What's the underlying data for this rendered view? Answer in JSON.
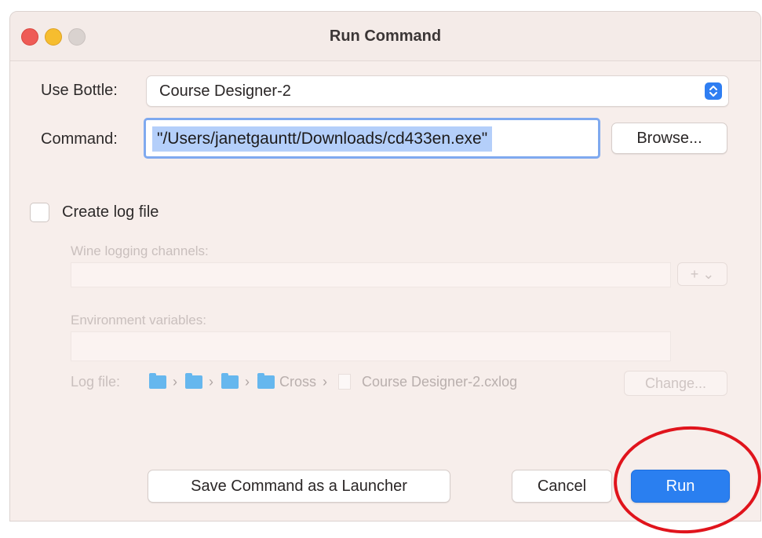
{
  "window": {
    "title": "Run Command"
  },
  "form": {
    "use_bottle_label": "Use Bottle:",
    "bottle_value": "Course Designer-2",
    "command_label": "Command:",
    "command_value": "\"/Users/janetgauntt/Downloads/cd433en.exe\"",
    "browse_label": "Browse..."
  },
  "logging": {
    "create_log_label": "Create log file",
    "create_log_checked": false,
    "wine_channels_label": "Wine logging channels:",
    "wine_channels_value": "",
    "plus_label": "+ ⌄",
    "env_vars_label": "Environment variables:",
    "env_vars_value": "",
    "log_file_label": "Log file:",
    "log_path_crumb": "Cross",
    "log_file_name": "Course Designer-2.cxlog",
    "change_label": "Change..."
  },
  "footer": {
    "save_launcher_label": "Save Command as a Launcher",
    "cancel_label": "Cancel",
    "run_label": "Run"
  },
  "colors": {
    "accent": "#2a7ff0",
    "annotation": "#e0141c",
    "close": "#ee5b56",
    "minimize": "#f6bd2f"
  }
}
